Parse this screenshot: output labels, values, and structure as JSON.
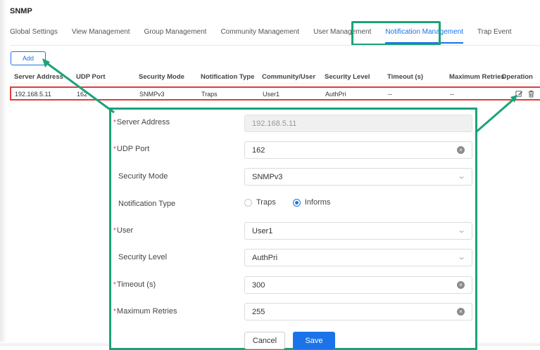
{
  "page": {
    "title": "SNMP"
  },
  "tabs": [
    {
      "label": "Global Settings"
    },
    {
      "label": "View Management"
    },
    {
      "label": "Group Management"
    },
    {
      "label": "Community Management"
    },
    {
      "label": "User Management"
    },
    {
      "label": "Notification Management",
      "active": true
    },
    {
      "label": "Trap Event"
    }
  ],
  "toolbar": {
    "add_label": "Add"
  },
  "table": {
    "headers": [
      "Server Address",
      "UDP Port",
      "Security Mode",
      "Notification Type",
      "Community/User",
      "Security Level",
      "Timeout (s)",
      "Maximum Retries",
      "Operation"
    ],
    "rows": [
      {
        "server_address": "192.168.5.11",
        "udp_port": "162",
        "security_mode": "SNMPv3",
        "notification_type": "Traps",
        "community_user": "User1",
        "security_level": "AuthPri",
        "timeout": "--",
        "max_retries": "--"
      }
    ]
  },
  "form": {
    "server_address": {
      "label": "Server Address",
      "value": "192.168.5.11",
      "required": true
    },
    "udp_port": {
      "label": "UDP Port",
      "value": "162",
      "required": true
    },
    "security_mode": {
      "label": "Security Mode",
      "value": "SNMPv3"
    },
    "notification_type": {
      "label": "Notification Type",
      "options": [
        "Traps",
        "Informs"
      ],
      "selected": "Informs"
    },
    "user": {
      "label": "User",
      "value": "User1",
      "required": true
    },
    "security_level": {
      "label": "Security Level",
      "value": "AuthPri"
    },
    "timeout": {
      "label": "Timeout (s)",
      "value": "300",
      "required": true
    },
    "max_retries": {
      "label": "Maximum Retries",
      "value": "255",
      "required": true
    },
    "cancel_label": "Cancel",
    "save_label": "Save",
    "required_mark": "*"
  },
  "colors": {
    "accent": "#1a73e8",
    "highlight": "#1aa37a",
    "error_outline": "#e23b3b"
  },
  "icons": {
    "edit": "edit-icon",
    "delete": "trash-icon",
    "clear": "clear-icon",
    "dropdown": "chevron-down-icon"
  }
}
